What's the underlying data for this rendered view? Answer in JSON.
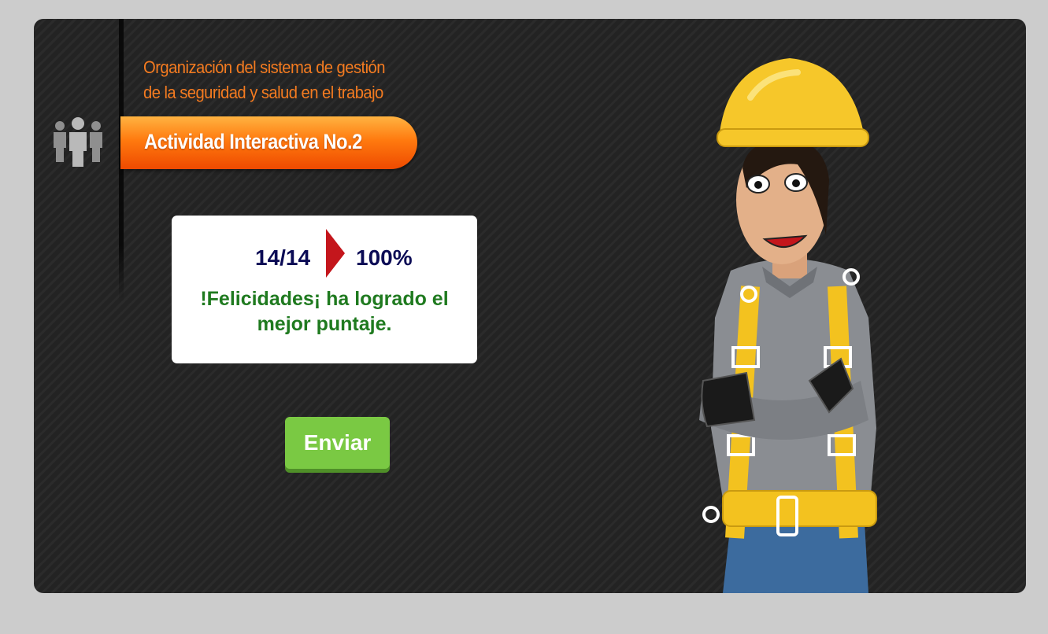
{
  "header": {
    "title_line1": "Organización del sistema de gestión",
    "title_line2": "de la seguridad y salud en el trabajo",
    "banner_label": "Actividad Interactiva No.2"
  },
  "result": {
    "score": "14/14",
    "percent": "100%",
    "message": "!Felicidades¡ ha logrado el mejor puntaje."
  },
  "actions": {
    "send_label": "Enviar"
  },
  "icons": {
    "header": "people-group-icon",
    "result_separator": "arrow-right-icon",
    "character": "construction-worker-illustration"
  },
  "colors": {
    "page_background": "#cccccc",
    "stage_background": "#232323",
    "title": "#f47b20",
    "banner": "#ff7a0f",
    "score": "#0b0b55",
    "message": "#1f7a1f",
    "send_button": "#7ac943"
  }
}
